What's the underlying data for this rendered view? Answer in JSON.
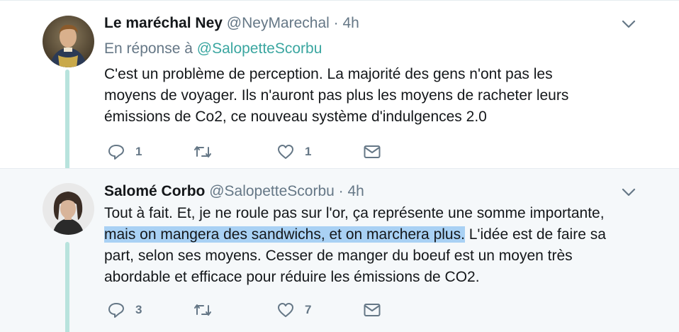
{
  "tweets": [
    {
      "author_name": "Le maréchal Ney",
      "handle": "@NeyMarechal",
      "separator": "·",
      "time": "4h",
      "reply_prefix": "En réponse à",
      "reply_to": "@SalopetteScorbu",
      "text_lines": [
        "C'est un problème de perception. La majorité des gens n'ont pas les",
        "moyens de voyager. Ils n'auront pas plus les moyens de racheter leurs",
        "émissions de Co2, ce nouveau système d'indulgences 2.0"
      ],
      "reply_count": "1",
      "retweet_count": "",
      "like_count": "1",
      "icons": {
        "reply": "reply-icon",
        "retweet": "retweet-icon",
        "like": "heart-icon",
        "dm": "envelope-icon",
        "menu": "chevron-down-icon"
      }
    },
    {
      "author_name": "Salomé Corbo",
      "handle": "@SalopetteScorbu",
      "separator": "·",
      "time": "4h",
      "text_line_1": "Tout à fait. Et, je ne roule pas sur l'or, ça représente une somme importante,",
      "text_line_2_highlight": "mais on mangera des sandwichs, et on marchera plus.",
      "text_line_2_rest": " L'idée est de faire sa",
      "text_line_3": "part, selon ses moyens. Cesser de manger du boeuf est un moyen très",
      "text_line_4": "abordable et efficace pour réduire les émissions de CO2.",
      "reply_count": "3",
      "retweet_count": "",
      "like_count": "7",
      "highlight_color": "#a9d1f4"
    }
  ],
  "colors": {
    "accent": "#3aa6a0",
    "thread_line": "#b8e3dd",
    "secondary_text": "#657786",
    "hover_background": "#f5f8fa"
  }
}
